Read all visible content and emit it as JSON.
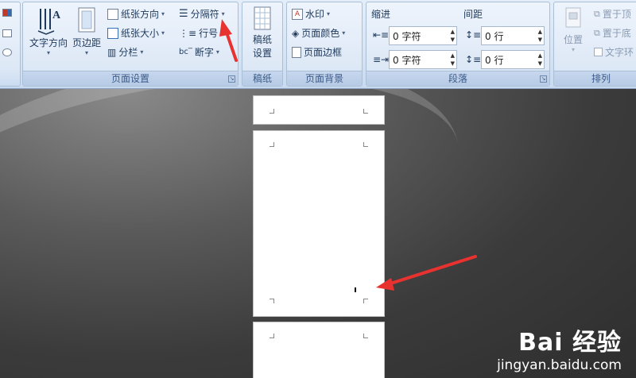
{
  "ribbon": {
    "page_setup": {
      "label": "页面设置",
      "text_direction": "文字方向",
      "margins": "页边距",
      "orientation": "纸张方向",
      "size": "纸张大小",
      "columns": "分栏",
      "breaks": "分隔符",
      "line_numbers": "行号",
      "hyphenation": "断字"
    },
    "manuscript": {
      "label": "稿纸",
      "setup_line1": "稿纸",
      "setup_line2": "设置"
    },
    "background": {
      "label": "页面背景",
      "watermark": "水印",
      "page_color": "页面颜色",
      "page_borders": "页面边框"
    },
    "paragraph": {
      "label": "段落",
      "indent": "缩进",
      "spacing": "间距",
      "indent_left": "0 字符",
      "indent_right": "0 字符",
      "spacing_before": "0 行",
      "spacing_after": "0 行"
    },
    "arrange": {
      "label": "排列",
      "position": "位置",
      "bring_front": "置于顶",
      "send_back": "置于底",
      "text_wrap": "文字环"
    }
  },
  "watermark": {
    "logo": "Bai 经验",
    "url": "jingyan.baidu.com"
  },
  "colors": {
    "annotation_arrow": "#e8322f"
  }
}
